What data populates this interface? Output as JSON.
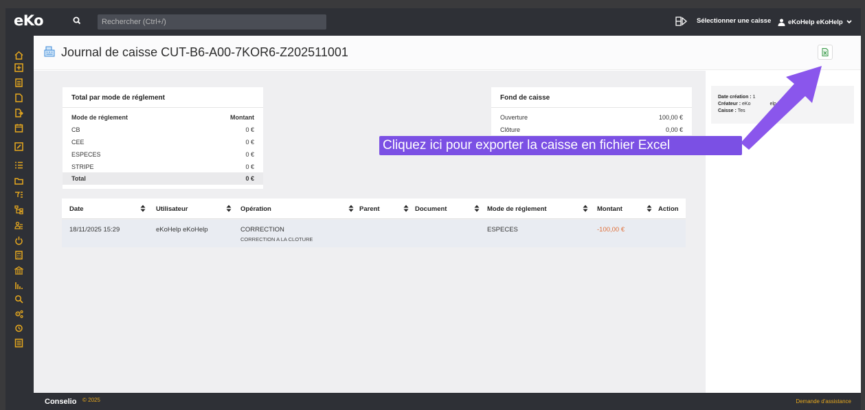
{
  "app": {
    "logo": "eKo"
  },
  "topbar": {
    "search_placeholder": "Rechercher (Ctrl+/)",
    "select_register_label": "Sélectionner une caisse",
    "user_label": "eKoHelp eKoHelp"
  },
  "sidebar": {
    "icons": [
      "home-icon",
      "plus-square-icon",
      "document-icon",
      "file-icon",
      "file-export-icon",
      "calendar-icon",
      "edit-square-icon",
      "list-icon",
      "folder-icon",
      "list-filter-icon",
      "hierarchy-icon",
      "users-icon",
      "power-icon",
      "calculator-icon",
      "bank-icon",
      "bar-chart-icon",
      "search-icon",
      "settings-icon",
      "hand-coins-icon",
      "register-icon"
    ]
  },
  "header": {
    "title": "Journal de caisse CUT-B6-A00-7KOR6-Z202511001"
  },
  "payments_card": {
    "title": "Total par mode de réglement",
    "col_mode": "Mode de réglement",
    "col_amount": "Montant",
    "rows": [
      {
        "mode": "CB",
        "amount": "0 €"
      },
      {
        "mode": "CEE",
        "amount": "0 €"
      },
      {
        "mode": "ESPECES",
        "amount": "0 €"
      },
      {
        "mode": "STRIPE",
        "amount": "0 €"
      }
    ],
    "total_label": "Total",
    "total_amount": "0 €"
  },
  "fund_card": {
    "title": "Fond de caisse",
    "rows": [
      {
        "label": "Ouverture",
        "amount": "100,00 €"
      },
      {
        "label": "Clôture",
        "amount": "0,00 €"
      }
    ]
  },
  "table": {
    "headers": [
      "Date",
      "Utilisateur",
      "Opération",
      "Parent",
      "Document",
      "Mode de réglement",
      "Montant",
      "Action"
    ],
    "rows": [
      {
        "date": "18/11/2025 15:29",
        "user": "eKoHelp eKoHelp",
        "operation": "CORRECTION",
        "operation_detail": "CORRECTION A LA CLOTURE",
        "parent": "",
        "document": "",
        "mode": "ESPECES",
        "amount": "-100,00 €"
      }
    ]
  },
  "info_panel": {
    "created_label": "Date création :",
    "created_value": "1",
    "created_tail": "7",
    "creator_label": "Créateur :",
    "creator_value": "eKo",
    "creator_tail": "elp",
    "register_label": "Caisse :",
    "register_value": "Tes"
  },
  "tooltip": {
    "text": "Cliquez ici pour exporter la caisse en fichier Excel"
  },
  "footer": {
    "brand": "Conselio",
    "year": "© 2025",
    "help": "Demande d'assistance"
  },
  "colors": {
    "accent": "#e8a91e",
    "dark": "#2e3036",
    "tooltip": "#7b50e4",
    "negative": "#e0703a"
  }
}
